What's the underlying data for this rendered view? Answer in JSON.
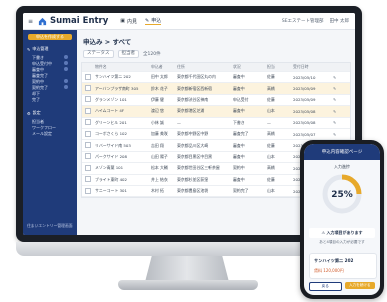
{
  "app": {
    "name": "Sumai Entry",
    "hamburger": "≡"
  },
  "topbar": {
    "nav": [
      {
        "label": "内見"
      },
      {
        "label": "申込"
      }
    ],
    "right": [
      "SEエステート管理部",
      "田中 太郎"
    ]
  },
  "sidebar": {
    "action": "申込を作成する",
    "sections": [
      {
        "title": "申込管理",
        "items": [
          "下書き",
          "申込受付中",
          "審査中",
          "審査完了",
          "契約中",
          "契約完了",
          "却下",
          "完了"
        ]
      },
      {
        "title": "設定",
        "items": [
          "担当者",
          "ワークフロー",
          "メール設定"
        ]
      }
    ],
    "footer": "住まいエントリー管理画面"
  },
  "main": {
    "breadcrumb": "申込み > すべて",
    "filters": [
      "ステータス",
      "担当者"
    ],
    "count": "全120件",
    "columns": [
      "",
      "物件名",
      "申込者",
      "住所",
      "状況",
      "担当",
      "受付日時",
      ""
    ],
    "rows": [
      {
        "property": "サンハイツ第二 202",
        "applicant": "田中 太郎",
        "address": "東京都千代田区丸の内",
        "status": "審査中",
        "staff": "佐藤",
        "date": "2023/05/10",
        "hl": false
      },
      {
        "property": "アーバンプラザ南町 305",
        "applicant": "鈴木 花子",
        "address": "東京都新宿区西新宿",
        "status": "審査中",
        "staff": "高橋",
        "date": "2023/05/09",
        "hl": true
      },
      {
        "property": "グランメゾン 101",
        "applicant": "伊藤 健",
        "address": "東京都渋谷区神南",
        "status": "申込受付",
        "staff": "佐藤",
        "date": "2023/05/09",
        "hl": false
      },
      {
        "property": "ハイムコート 4F",
        "applicant": "渡辺 悠",
        "address": "東京都港区芝浦",
        "status": "審査中",
        "staff": "山本",
        "date": "2023/05/08",
        "hl": true
      },
      {
        "property": "グリーンヒル 201",
        "applicant": "小林 誠",
        "address": "—",
        "status": "下書き",
        "staff": "—",
        "date": "2023/05/08",
        "hl": false
      },
      {
        "property": "コーポさくら 102",
        "applicant": "加藤 美咲",
        "address": "東京都中野区中野",
        "status": "審査完了",
        "staff": "高橋",
        "date": "2023/05/07",
        "hl": false
      },
      {
        "property": "リバーサイド南 503",
        "applicant": "吉田 翔",
        "address": "東京都品川区大崎",
        "status": "審査中",
        "staff": "佐藤",
        "date": "2023/05/07",
        "hl": false
      },
      {
        "property": "パークサイド 208",
        "applicant": "山田 陽子",
        "address": "東京都目黒区中目黒",
        "status": "審査中",
        "staff": "山本",
        "date": "2023/05/06",
        "hl": false
      },
      {
        "property": "メゾン青葉 101",
        "applicant": "松本 大輔",
        "address": "東京都世田谷区三軒茶屋",
        "status": "契約中",
        "staff": "高橋",
        "date": "2023/05/06",
        "hl": false
      },
      {
        "property": "ブライト東町 402",
        "applicant": "井上 結衣",
        "address": "東京都杉並区荻窪",
        "status": "審査中",
        "staff": "佐藤",
        "date": "2023/05/05",
        "hl": false
      },
      {
        "property": "サニーコート 301",
        "applicant": "木村 拓",
        "address": "東京都豊島区池袋",
        "status": "契約完了",
        "staff": "山本",
        "date": "2023/05/05",
        "hl": false
      }
    ]
  },
  "phone": {
    "header": "申込内容確認ページ",
    "subtitle": "入力進捗",
    "progress_label": "25%",
    "progress": 0.25,
    "message": "入力項目があります",
    "warning": "あと4項目の入力が必要です",
    "card_name": "サンハイツ第二 202",
    "card_price": "賃料 120,000円",
    "btn_back": "戻る",
    "btn_next": "入力を続ける"
  },
  "colors": {
    "navy": "#1f3b7a",
    "accent": "#e7a92b"
  }
}
